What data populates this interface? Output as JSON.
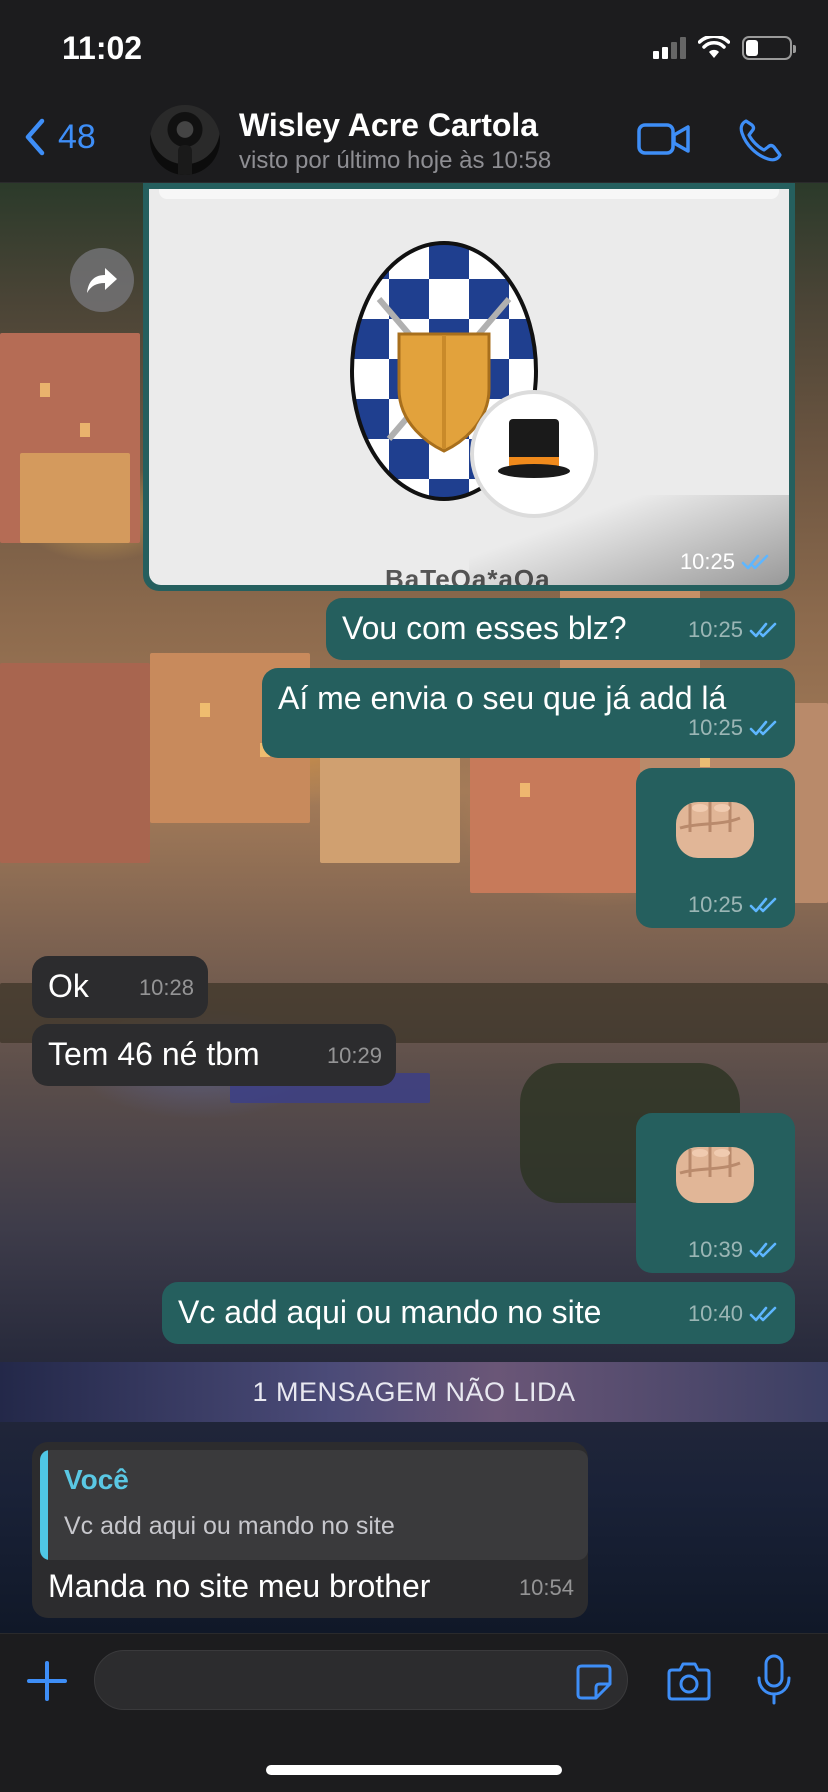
{
  "status_bar": {
    "time": "11:02"
  },
  "header": {
    "back_count": "48",
    "contact_name": "Wisley Acre Cartola",
    "last_seen": "visto por último hoje às 10:58"
  },
  "image_message": {
    "caption_cut": "BaTeOa*aOa",
    "time": "10:25"
  },
  "messages": [
    {
      "direction": "out",
      "text": "Vou com esses blz?",
      "time": "10:25"
    },
    {
      "direction": "out",
      "text": "Aí me envia o seu que já add lá",
      "time": "10:25"
    },
    {
      "direction": "out",
      "sticker": "fist-emoji",
      "time": "10:25"
    },
    {
      "direction": "in",
      "text": "Ok",
      "time": "10:28"
    },
    {
      "direction": "in",
      "text": "Tem 46 né tbm",
      "time": "10:29"
    },
    {
      "direction": "out",
      "sticker": "fist-emoji",
      "time": "10:39"
    },
    {
      "direction": "out",
      "text": "Vc add aqui ou mando no site",
      "time": "10:40"
    }
  ],
  "unread_divider": "1 MENSAGEM NÃO LIDA",
  "reply_message": {
    "quoted_author": "Você",
    "quoted_text": "Vc add aqui ou mando no site",
    "text": "Manda no site meu brother",
    "time": "10:54"
  },
  "input": {
    "value": "",
    "placeholder": ""
  },
  "icons": {
    "back": "chevron-left-icon",
    "video": "video-camera-icon",
    "call": "phone-icon",
    "forward": "forward-arrow-icon",
    "attach": "plus-icon",
    "sticker": "sticker-icon",
    "camera": "camera-icon",
    "mic": "microphone-icon",
    "read": "double-check-icon"
  },
  "colors": {
    "accent": "#3e8ef7",
    "outgoing_bubble": "#255f5e",
    "incoming_bubble": "#2c2c2e",
    "read_ticks": "#5eb6ff",
    "quote_bar": "#4fc7e6"
  }
}
